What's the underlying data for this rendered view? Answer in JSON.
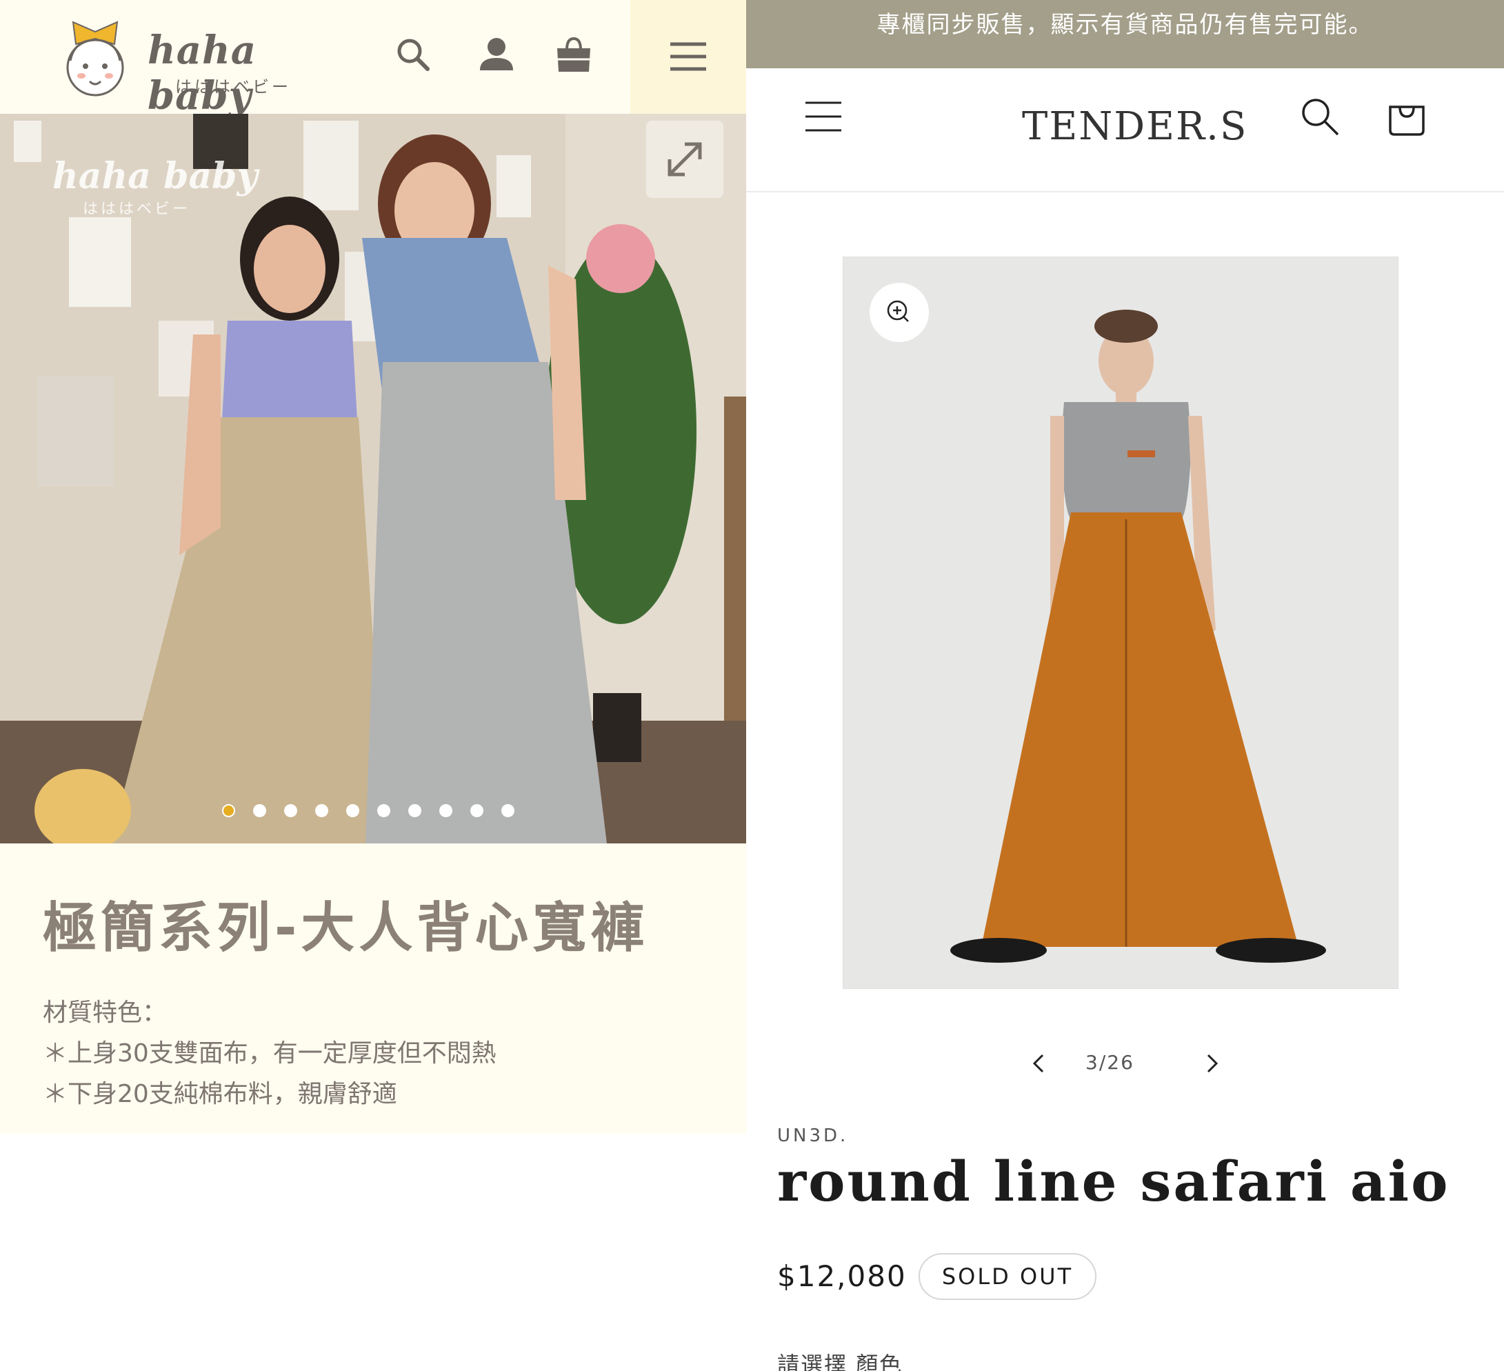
{
  "left": {
    "brand": {
      "name": "haha baby",
      "subtitle": "はははベビー"
    },
    "watermark": {
      "name": "haha baby",
      "subtitle": "はははベビー"
    },
    "icons": [
      "search-icon",
      "account-icon",
      "cart-icon",
      "menu-icon"
    ],
    "gallery": {
      "slide_count": 10,
      "active_slide": 1
    },
    "product": {
      "title": "極簡系列-大人背心寬褲",
      "material_heading": "材質特色：",
      "material_lines": [
        "＊上身30支雙面布，有一定厚度但不悶熱",
        "＊下身20支純棉布料，親膚舒適"
      ]
    },
    "colors": {
      "header_bg": "#fffcf0",
      "menu_bg": "#fdf6d9",
      "text": "#8b8177",
      "accent": "#e6ad20"
    }
  },
  "right": {
    "announcement": "專櫃同步販售，顯示有貨商品仍有售完可能。",
    "brand": "TENDER.S",
    "icons": [
      "menu-icon",
      "search-icon",
      "cart-icon",
      "zoom-icon",
      "chevron-left-icon",
      "chevron-right-icon"
    ],
    "gallery": {
      "counter": "3/26"
    },
    "product": {
      "vendor": "UN3D.",
      "title": "round line safari aio",
      "price": "$12,080",
      "badge": "SOLD OUT",
      "option_label": "請選擇 顏色"
    },
    "colors": {
      "announcement_bg": "#a39f8a",
      "text": "#1c1c1c"
    }
  }
}
